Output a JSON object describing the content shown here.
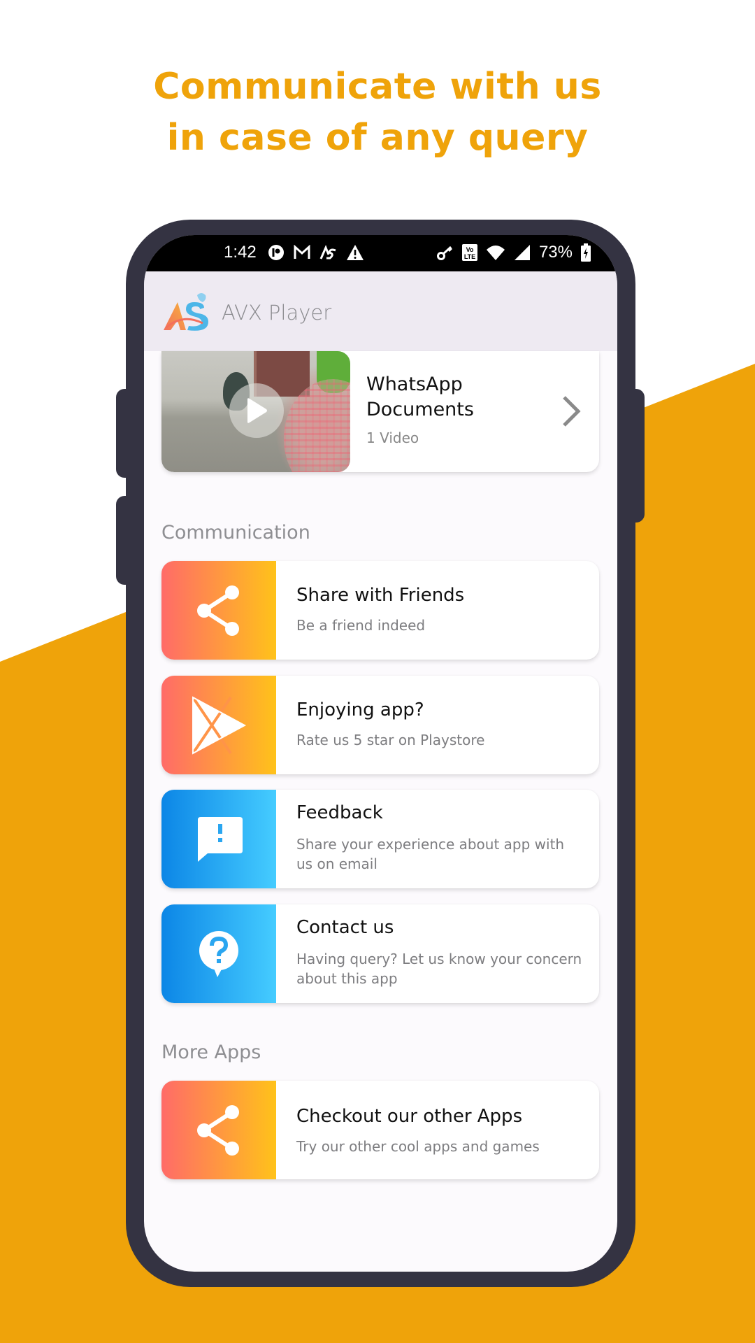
{
  "headline": {
    "line1": "Communicate with us",
    "line2": "in case of any query"
  },
  "colors": {
    "accent_orange": "#EFA30A",
    "phone_frame": "#343342",
    "warm_gradient": [
      "#FF6B68",
      "#FFC21A"
    ],
    "cool_gradient": [
      "#0C86E6",
      "#45CCFF"
    ]
  },
  "status_bar": {
    "time": "1:42",
    "left_icons": [
      "pocket-casts-icon",
      "gmail-icon",
      "avx-app-icon",
      "warning-icon"
    ],
    "right_icons": [
      "vpn-key-icon",
      "volte-icon",
      "wifi-icon",
      "cell-signal-icon"
    ],
    "battery_percent": "73%",
    "battery_icon": "battery-charging-icon"
  },
  "app_bar": {
    "title": "AVX Player",
    "logo": "avx-logo"
  },
  "folder": {
    "title_line1": "WhatsApp",
    "title_line2": "Documents",
    "count": "1 Video"
  },
  "sections": {
    "communication": "Communication",
    "more_apps": "More Apps"
  },
  "communication_items": [
    {
      "title": "Share with Friends",
      "subtitle": "Be a friend indeed",
      "icon": "share-icon"
    },
    {
      "title": "Enjoying app?",
      "subtitle": "Rate us 5 star on Playstore",
      "icon": "play-store-icon"
    },
    {
      "title": "Feedback",
      "subtitle": "Share your experience about app with us on email",
      "icon": "feedback-icon"
    },
    {
      "title": "Contact us",
      "subtitle": "Having query? Let us know your concern about this app",
      "icon": "help-icon"
    }
  ],
  "more_apps_items": [
    {
      "title": "Checkout our other Apps",
      "subtitle": "Try our other cool apps and games",
      "icon": "share-icon"
    }
  ]
}
